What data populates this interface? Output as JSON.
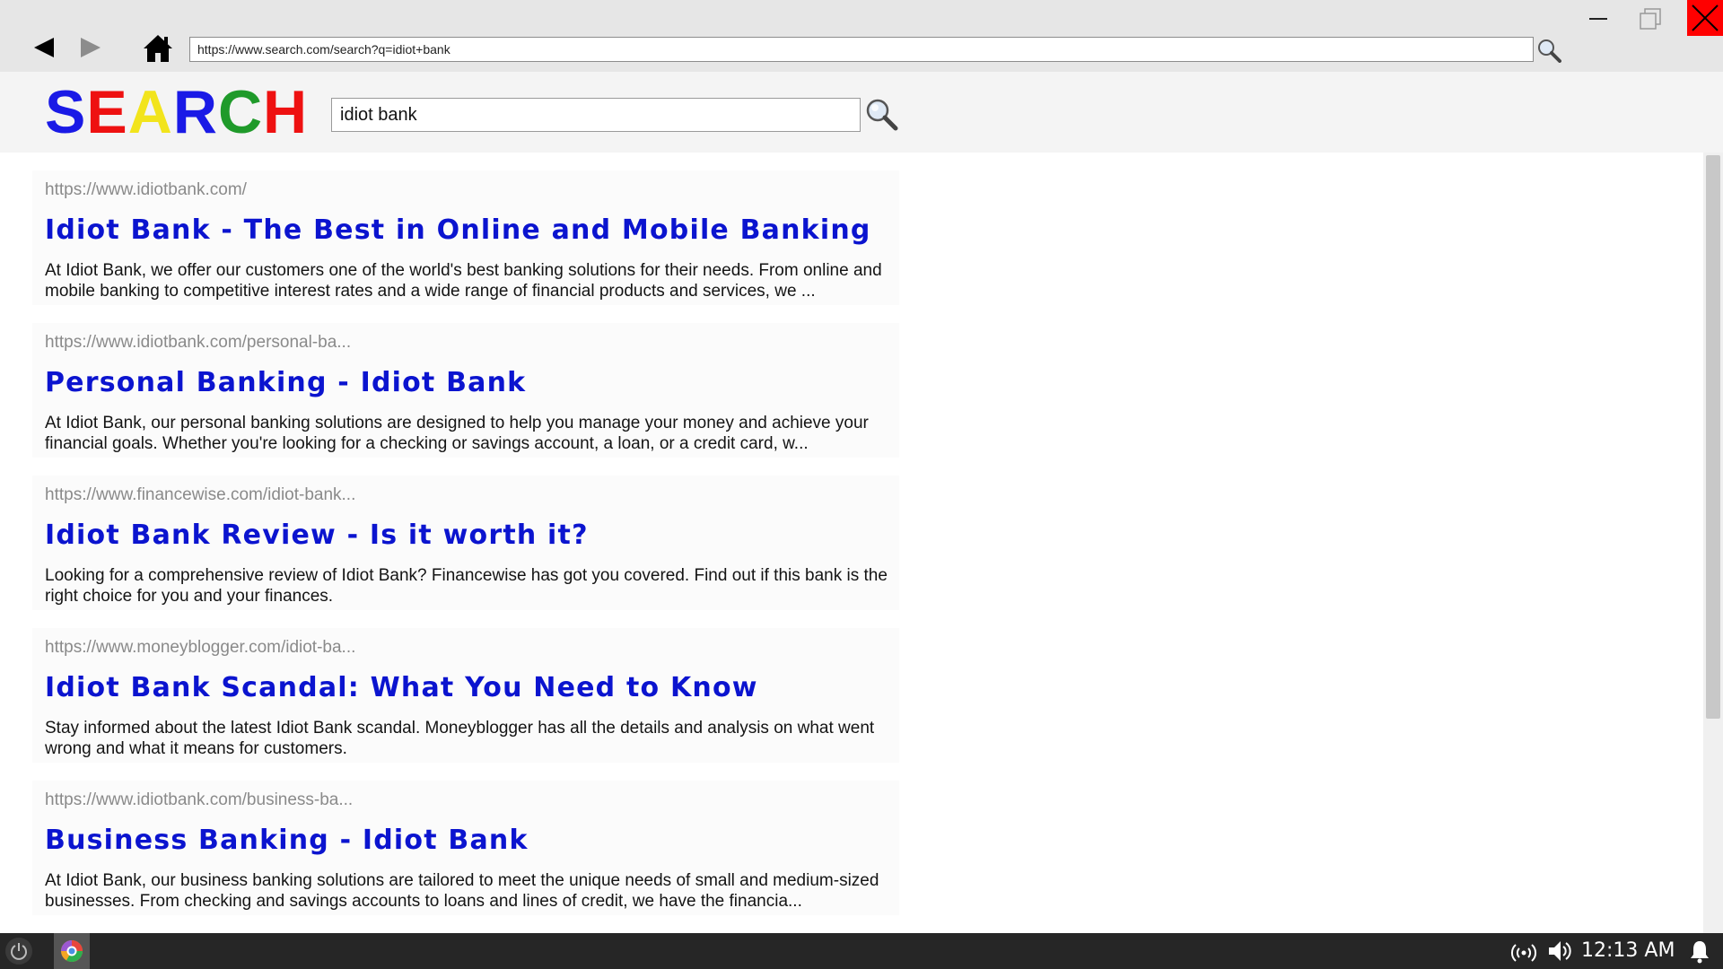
{
  "browser": {
    "address": "https://www.search.com/search?q=idiot+bank",
    "icons": {
      "back": "back-arrow-icon",
      "forward": "forward-arrow-icon",
      "home": "home-icon",
      "address_search": "magnifier-icon",
      "minimize": "minimize-icon",
      "maximize": "maximize-icon",
      "close": "close-icon"
    },
    "colors": {
      "chrome": "#e6e6e6",
      "close_bg": "#ff0000"
    }
  },
  "search": {
    "logo_letters": [
      {
        "char": "S",
        "color": "#1a1ae6"
      },
      {
        "char": "E",
        "color": "#ee1111"
      },
      {
        "char": "A",
        "color": "#f2e41c"
      },
      {
        "char": "R",
        "color": "#1a1ae6"
      },
      {
        "char": "C",
        "color": "#1f9a2a"
      },
      {
        "char": "H",
        "color": "#ee1111"
      }
    ],
    "query": "idiot bank"
  },
  "results": [
    {
      "url": "https://www.idiotbank.com/",
      "title": "Idiot Bank - The Best in Online and Mobile Banking",
      "description": "At Idiot Bank, we offer our customers one of the world's best banking solutions for their needs. From online and mobile banking to competitive interest rates and a wide range of financial products and services, we ..."
    },
    {
      "url": "https://www.idiotbank.com/personal-ba...",
      "title": "Personal Banking - Idiot Bank",
      "description": "At Idiot Bank, our personal banking solutions are designed to help you manage your money and achieve your financial goals. Whether you're looking for a checking or savings account, a loan, or a credit card, w..."
    },
    {
      "url": "https://www.financewise.com/idiot-bank...",
      "title": "Idiot Bank Review - Is it worth it?",
      "description": "Looking for a comprehensive review of Idiot Bank? Financewise has got you covered. Find out if this bank is the right choice for you and your finances."
    },
    {
      "url": "https://www.moneyblogger.com/idiot-ba...",
      "title": "Idiot Bank Scandal: What You Need to Know",
      "description": "Stay informed about the latest Idiot Bank scandal. Moneyblogger has all the details and analysis on what went wrong and what it means for customers."
    },
    {
      "url": "https://www.idiotbank.com/business-ba...",
      "title": "Business Banking - Idiot Bank",
      "description": "At Idiot Bank, our business banking solutions are tailored to meet the unique needs of small and medium-sized businesses. From checking and savings accounts to loans and lines of credit, we have the financia..."
    }
  ],
  "taskbar": {
    "clock": "12:13 AM",
    "icons": {
      "power": "power-icon",
      "browser_app": "browser-app-icon",
      "network": "network-icon",
      "volume": "volume-icon",
      "notifications": "bell-icon"
    }
  },
  "colors": {
    "link": "#0b14cf",
    "url_text": "#8a8a8a",
    "taskbar": "#262626"
  }
}
